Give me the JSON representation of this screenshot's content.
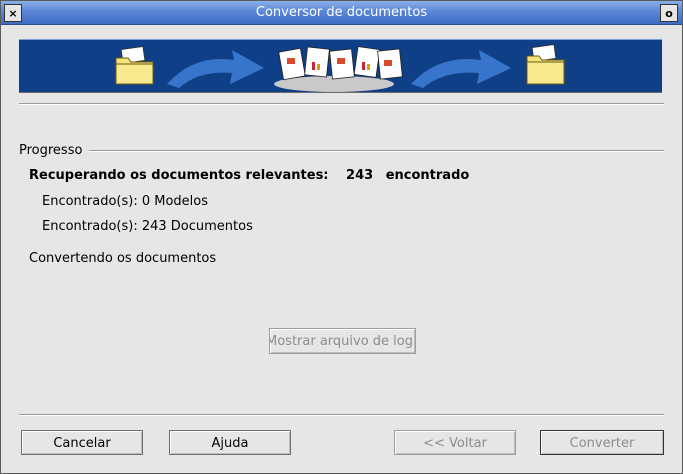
{
  "window": {
    "title": "Conversor de documentos",
    "close_glyph": "×",
    "maximize_glyph": "o"
  },
  "progress": {
    "section_label": "Progresso",
    "retrieving_label": "Recuperando os documentos relevantes:",
    "found_count": "243",
    "found_word": "encontrado",
    "found_templates": "Encontrado(s): 0 Modelos",
    "found_documents": "Encontrado(s): 243 Documentos",
    "converting_label": "Convertendo os documentos"
  },
  "log_button": "Mostrar arquivo de log",
  "buttons": {
    "cancel": "Cancelar",
    "help": "Ajuda",
    "back": "<< Voltar",
    "convert": "Converter"
  },
  "colors": {
    "banner": "#0f3f86",
    "titlebar": "#5b87d6"
  },
  "icons": [
    "source-folder-icon",
    "arrow-right-icon",
    "documents-stack-icon",
    "arrow-right-icon",
    "target-folder-icon"
  ]
}
